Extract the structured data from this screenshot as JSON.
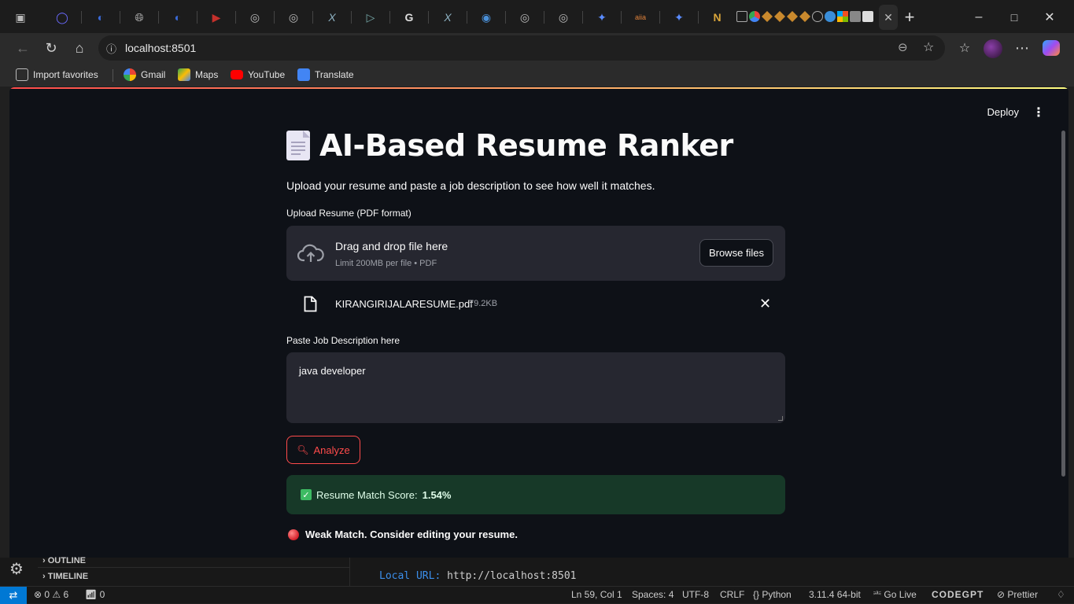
{
  "browser": {
    "url": "localhost:8501",
    "tabs": [
      "",
      "",
      "",
      "",
      "",
      "",
      "",
      "",
      "",
      "",
      "",
      "",
      "",
      "",
      "",
      "",
      "",
      ""
    ],
    "favorites": [
      {
        "label": "Import favorites"
      },
      {
        "label": "Gmail"
      },
      {
        "label": "Maps"
      },
      {
        "label": "YouTube"
      },
      {
        "label": "Translate"
      }
    ]
  },
  "app": {
    "deploy_label": "Deploy",
    "title": "AI-Based Resume Ranker",
    "subtitle": "Upload your resume and paste a job description to see how well it matches.",
    "upload_label": "Upload Resume (PDF format)",
    "drag_text": "Drag and drop file here",
    "limit_text": "Limit 200MB per file • PDF",
    "browse_label": "Browse files",
    "file_name": "KIRANGIRIJALARESUME.pdf",
    "file_size": "79.2KB",
    "jd_label": "Paste Job Description here",
    "jd_value": "java developer",
    "analyze_label": "Analyze",
    "score_prefix": "Resume Match Score: ",
    "score_value": "1.54%",
    "weak_text": "Weak Match. Consider editing your resume."
  },
  "vscode": {
    "outline_label": "OUTLINE",
    "timeline_label": "TIMELINE",
    "terminal_key": "Local URL:",
    "terminal_value": "http://localhost:8501"
  },
  "statusbar": {
    "errors": "0",
    "warnings": "6",
    "ports": "0",
    "position": "Ln 59, Col 1",
    "spaces": "Spaces: 4",
    "encoding": "UTF-8",
    "eol": "CRLF",
    "language": "Python",
    "interpreter": "3.11.4 64-bit",
    "golive": "Go Live",
    "codegpt": "CODEGPT",
    "prettier": "Prettier"
  },
  "colors": {
    "accent": "#ff4b4b",
    "background": "#0e1117",
    "widget": "#262730",
    "success_bg": "#173928"
  }
}
